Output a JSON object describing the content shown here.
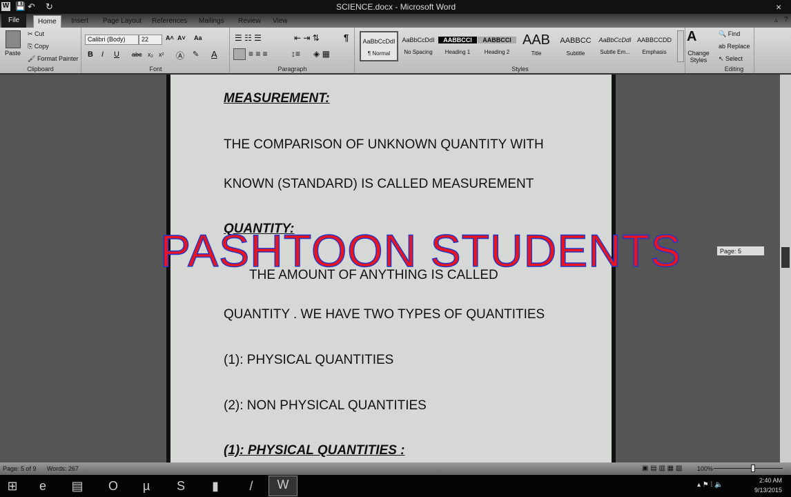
{
  "window": {
    "title": "SCIENCE.docx - Microsoft Word",
    "close": "×",
    "help": "?",
    "minimize_ribbon": "▵"
  },
  "quick_access": {
    "word": "W",
    "save": "💾",
    "undo": "↶",
    "redo": "↻"
  },
  "tabs": [
    "File",
    "Home",
    "Insert",
    "Page Layout",
    "References",
    "Mailings",
    "Review",
    "View"
  ],
  "ribbon": {
    "clipboard": {
      "label": "Clipboard",
      "paste": "Paste",
      "cut": "Cut",
      "copy": "Copy",
      "format_painter": "Format Painter"
    },
    "font": {
      "label": "Font",
      "family": "Calibri (Body)",
      "size": "22",
      "bold": "B",
      "italic": "I",
      "underline": "U",
      "strike": "abc",
      "sub": "x₂",
      "sup": "x²",
      "grow": "A˄",
      "shrink": "A˅",
      "case": "Aa"
    },
    "paragraph": {
      "label": "Paragraph",
      "pilcrow": "¶"
    },
    "styles": {
      "label": "Styles",
      "items": [
        {
          "preview": "AaBbCcDdI",
          "name": "¶ Normal"
        },
        {
          "preview": "AaBbCcDdI",
          "name": "No Spacing"
        },
        {
          "preview": "AABBCCI",
          "name": "Heading 1"
        },
        {
          "preview": "AABBCCI",
          "name": "Heading 2"
        },
        {
          "preview": "AAB",
          "name": "Title"
        },
        {
          "preview": "AABBCC",
          "name": "Subtitle"
        },
        {
          "preview": "AaBbCcDdI",
          "name": "Subtle Em..."
        },
        {
          "preview": "AABBCCDD",
          "name": "Emphasis"
        }
      ],
      "change_styles": "Change Styles"
    },
    "editing": {
      "label": "Editing",
      "find": "Find",
      "replace": "Replace",
      "select": "Select"
    }
  },
  "document": {
    "lines": [
      {
        "text": "MEASUREMENT:",
        "style": "heading"
      },
      {
        "text": "THE COMPARISON OF UNKNOWN QUANTITY WITH"
      },
      {
        "text": "KNOWN (STANDARD) IS CALLED MEASUREMENT"
      },
      {
        "text": "QUANTITY:",
        "style": "heading"
      },
      {
        "text": "THE AMOUNT OF ANYTHING IS CALLED",
        "indent": true
      },
      {
        "text": "QUANTITY . WE HAVE TWO TYPES OF QUANTITIES"
      },
      {
        "text": "(1): PHYSICAL QUANTITIES"
      },
      {
        "text": "(2): NON PHYSICAL QUANTITIES"
      },
      {
        "text": "(1): PHYSICAL QUANTITIES :",
        "style": "heading"
      }
    ]
  },
  "watermark": "PASHTOON STUDENTS",
  "scroll_tooltip": "Page: 5",
  "status": {
    "page": "Page: 5 of 9",
    "words": "Words: 267",
    "zoom": "100%"
  },
  "taskbar": {
    "time": "2:40 AM",
    "date": "9/13/2015"
  }
}
